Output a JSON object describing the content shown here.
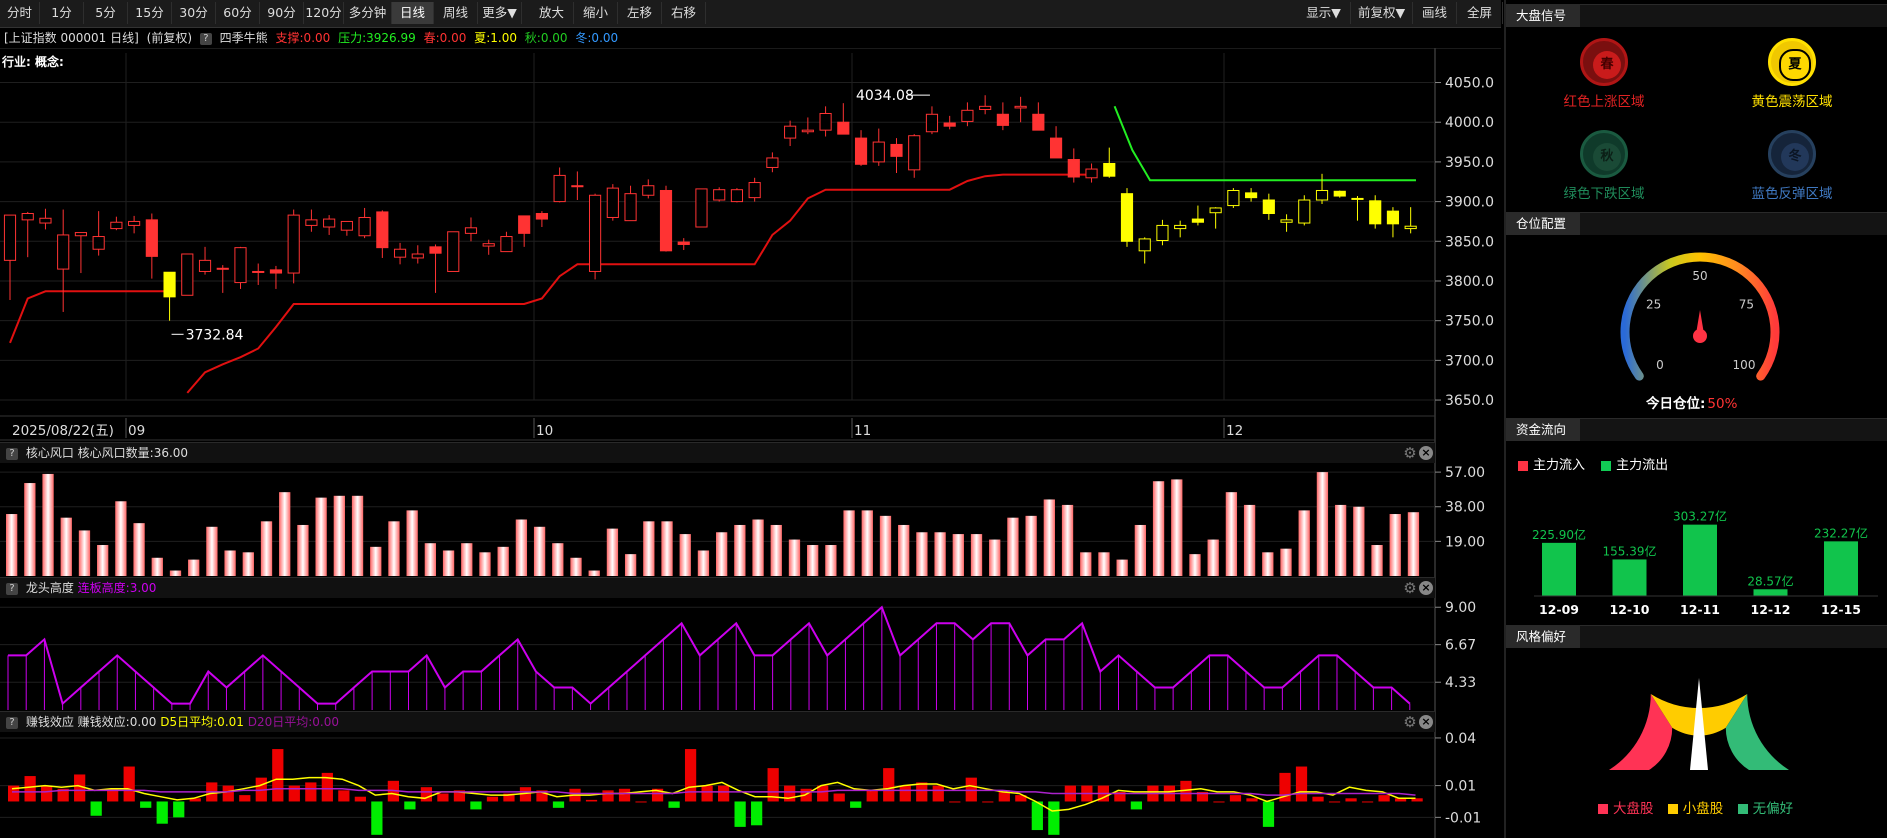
{
  "toolbar": {
    "periods": [
      "分时",
      "1分",
      "5分",
      "15分",
      "30分",
      "60分",
      "90分",
      "120分",
      "多分钟",
      "日线",
      "周线",
      "更多▼",
      "放大",
      "缩小",
      "左移",
      "右移"
    ],
    "active": "日线",
    "right": [
      "显示▼",
      "前复权▼",
      "画线",
      "全屏"
    ]
  },
  "info": {
    "index": "[上证指数 000001 日线]",
    "adjust": "(前复权)",
    "q": "?",
    "indicator": "四季牛熊",
    "support": "支撑:0.00",
    "pressure": "压力:3926.99",
    "spring": "春:0.00",
    "summer": "夏:1.00",
    "autumn": "秋:0.00",
    "winter": "冬:0.00",
    "industry": "行业: 概念:"
  },
  "colors": {
    "up": "#ff3333",
    "down": "#00e5e5",
    "yellow": "#ffff00",
    "support_line": "#e01010",
    "green_line": "#22ee22",
    "magenta": "#cc00ee",
    "bar_green": "#00ee00",
    "bar_red": "#ee0000"
  },
  "chart_data": [
    {
      "type": "candlestick",
      "title": "",
      "date_label": "2025/08/22(五)",
      "month_labels": [
        "09",
        "10",
        "11",
        "12"
      ],
      "y_ticks": [
        "4050.0",
        "4000.0",
        "3950.0",
        "3900.0",
        "3850.0",
        "3800.0",
        "3750.0",
        "3700.0",
        "3650.0"
      ],
      "ylim": [
        3640,
        4062
      ],
      "annotations": [
        {
          "text": "3732.84",
          "value": 3732.84,
          "index": 9
        },
        {
          "text": "4034.08",
          "value": 4034.08,
          "index": 52
        }
      ],
      "candles": [
        [
          3826,
          3883,
          3776,
          3883
        ],
        [
          3877,
          3887,
          3830,
          3885
        ],
        [
          3873,
          3891,
          3865,
          3879
        ],
        [
          3815,
          3890,
          3761,
          3858
        ],
        [
          3857,
          3860,
          3810,
          3861
        ],
        [
          3840,
          3888,
          3832,
          3856
        ],
        [
          3866,
          3881,
          3864,
          3874
        ],
        [
          3870,
          3882,
          3860,
          3875
        ],
        [
          3877,
          3885,
          3803,
          3831
        ],
        [
          3811,
          3811,
          3750,
          3780
        ],
        [
          3782,
          3834,
          3782,
          3834
        ],
        [
          3812,
          3843,
          3808,
          3826
        ],
        [
          3815,
          3820,
          3785,
          3816
        ],
        [
          3798,
          3843,
          3790,
          3842
        ],
        [
          3812,
          3822,
          3795,
          3812
        ],
        [
          3814,
          3819,
          3790,
          3810
        ],
        [
          3810,
          3890,
          3797,
          3883
        ],
        [
          3870,
          3890,
          3862,
          3877
        ],
        [
          3868,
          3883,
          3858,
          3878
        ],
        [
          3864,
          3870,
          3857,
          3875
        ],
        [
          3857,
          3892,
          3854,
          3880
        ],
        [
          3887,
          3889,
          3829,
          3842
        ],
        [
          3830,
          3848,
          3821,
          3840
        ],
        [
          3829,
          3845,
          3822,
          3834
        ],
        [
          3843,
          3846,
          3785,
          3835
        ],
        [
          3812,
          3862,
          3812,
          3862
        ],
        [
          3860,
          3880,
          3850,
          3867
        ],
        [
          3844,
          3852,
          3833,
          3847
        ],
        [
          3837,
          3862,
          3837,
          3856
        ],
        [
          3882,
          3882,
          3843,
          3860
        ],
        [
          3885,
          3888,
          3868,
          3878
        ],
        [
          3900,
          3943,
          3899,
          3933
        ],
        [
          3920,
          3938,
          3902,
          3919
        ],
        [
          3812,
          3910,
          3802,
          3908
        ],
        [
          3880,
          3922,
          3876,
          3917
        ],
        [
          3876,
          3920,
          3876,
          3910
        ],
        [
          3908,
          3928,
          3904,
          3920
        ],
        [
          3914,
          3920,
          3837,
          3838
        ],
        [
          3849,
          3854,
          3839,
          3846
        ],
        [
          3868,
          3912,
          3868,
          3916
        ],
        [
          3902,
          3918,
          3900,
          3915
        ],
        [
          3900,
          3917,
          3899,
          3915
        ],
        [
          3905,
          3930,
          3900,
          3924
        ],
        [
          3943,
          3962,
          3937,
          3955
        ],
        [
          3980,
          4002,
          3970,
          3995
        ],
        [
          3988,
          4006,
          3985,
          3990
        ],
        [
          3990,
          4020,
          3982,
          4011
        ],
        [
          4000,
          4024,
          3990,
          3985
        ],
        [
          3980,
          3990,
          3945,
          3947
        ],
        [
          3950,
          3992,
          3945,
          3975
        ],
        [
          3972,
          3980,
          3936,
          3957
        ],
        [
          3940,
          3985,
          3930,
          3983
        ],
        [
          3988,
          4020,
          3985,
          4010
        ],
        [
          3999,
          4008,
          3991,
          3995
        ],
        [
          4001,
          4025,
          3995,
          4015
        ],
        [
          4016,
          4034,
          4010,
          4020
        ],
        [
          4010,
          4025,
          3990,
          3996
        ],
        [
          4018,
          4032,
          4000,
          4020
        ],
        [
          4010,
          4025,
          3994,
          3990
        ],
        [
          3980,
          3995,
          3960,
          3955
        ],
        [
          3953,
          3967,
          3924,
          3931
        ],
        [
          3930,
          3948,
          3924,
          3941
        ],
        [
          3948,
          3968,
          3930,
          3932
        ],
        [
          3910,
          3917,
          3843,
          3850
        ],
        [
          3838,
          3855,
          3822,
          3853
        ],
        [
          3851,
          3877,
          3845,
          3870
        ],
        [
          3866,
          3876,
          3855,
          3870
        ],
        [
          3878,
          3895,
          3870,
          3874
        ],
        [
          3886,
          3893,
          3866,
          3892
        ],
        [
          3895,
          3917,
          3892,
          3914
        ],
        [
          3911,
          3917,
          3900,
          3905
        ],
        [
          3902,
          3910,
          3877,
          3885
        ],
        [
          3874,
          3884,
          3862,
          3877
        ],
        [
          3873,
          3908,
          3870,
          3902
        ],
        [
          3902,
          3935,
          3897,
          3914
        ],
        [
          3913,
          3914,
          3905,
          3907
        ],
        [
          3903,
          3907,
          3876,
          3904
        ],
        [
          3901,
          3908,
          3866,
          3872
        ],
        [
          3888,
          3893,
          3855,
          3872
        ],
        [
          3866,
          3893,
          3860,
          3869
        ]
      ],
      "candle_colors": [
        "up",
        "down",
        "up",
        "up",
        "down",
        "up",
        "up",
        "up",
        "up",
        "yellow",
        "up",
        "up",
        "up",
        "up",
        "up",
        "up",
        "up",
        "up",
        "up",
        "up",
        "up",
        "up",
        "up",
        "up",
        "up",
        "up",
        "up",
        "up",
        "up",
        "up",
        "up",
        "up",
        "up",
        "up",
        "up",
        "up",
        "up",
        "up",
        "up",
        "up",
        "up",
        "up",
        "up",
        "up",
        "up",
        "up",
        "up",
        "up",
        "up",
        "up",
        "up",
        "up",
        "up",
        "up",
        "up",
        "up",
        "up",
        "up",
        "up",
        "up",
        "up",
        "up",
        "yellow",
        "yellow",
        "yellow",
        "yellow",
        "yellow",
        "yellow",
        "yellow",
        "yellow",
        "yellow",
        "yellow",
        "yellow",
        "yellow",
        "yellow",
        "yellow",
        "yellow",
        "yellow",
        "yellow",
        "yellow"
      ],
      "support_line": [
        3722,
        3778,
        3787,
        3787,
        3787,
        3787,
        3787,
        3787,
        3787,
        3787,
        3659,
        3685,
        3695,
        3704,
        3715,
        3742,
        3771,
        3771,
        3771,
        3771,
        3771,
        3771,
        3771,
        3771,
        3771,
        3771,
        3771,
        3771,
        3771,
        3771,
        3778,
        3806,
        3821,
        3821,
        3821,
        3821,
        3821,
        3821,
        3821,
        3821,
        3821,
        3821,
        3821,
        3858,
        3876,
        3904,
        3915,
        3915,
        3915,
        3915,
        3915,
        3915,
        3915,
        3915,
        3926,
        3932,
        3934,
        3934,
        3934,
        3934,
        3934,
        3934
      ],
      "support_start_index": 0,
      "resistance_line": [
        4020,
        3965,
        3927,
        3927,
        3927,
        3927,
        3927,
        3927,
        3927,
        3927,
        3927,
        3927,
        3927,
        3927,
        3927,
        3927,
        3927,
        3927
      ],
      "resistance_start_index": 62
    },
    {
      "type": "bar",
      "title": "核心风口",
      "label": "核心风口数量:36.00",
      "y_ticks": [
        "57.00",
        "38.00",
        "19.00"
      ],
      "ylim": [
        0,
        62
      ],
      "values": [
        34,
        51,
        56,
        32,
        25,
        17,
        41,
        29,
        10,
        3,
        9,
        27,
        14,
        13,
        30,
        46,
        28,
        43,
        44,
        44,
        16,
        30,
        36,
        18,
        14,
        18,
        13,
        16,
        31,
        27,
        18,
        10,
        3,
        26,
        12,
        30,
        30,
        23,
        14,
        24,
        28,
        31,
        28,
        20,
        17,
        17,
        36,
        36,
        33,
        28,
        24,
        24,
        23,
        23,
        20,
        32,
        33,
        42,
        39,
        13,
        13,
        9,
        28,
        52,
        53,
        12,
        20,
        46,
        39,
        13,
        15,
        36,
        57,
        39,
        38,
        17,
        34,
        35
      ]
    },
    {
      "type": "line",
      "title": "龙头高度",
      "label": "连板高度:3.00",
      "y_ticks": [
        "9.00",
        "6.67",
        "4.33"
      ],
      "ylim": [
        2.6,
        9.7
      ],
      "values": [
        6,
        6,
        7,
        3,
        4,
        5,
        6,
        5,
        4,
        3,
        3,
        5,
        4,
        5,
        6,
        5,
        4,
        3,
        3,
        4,
        5,
        5,
        5,
        6,
        4,
        5,
        5,
        6,
        7,
        5,
        4,
        4,
        3,
        4,
        5,
        6,
        7,
        8,
        6,
        7,
        8,
        6,
        6,
        7,
        8,
        6,
        7,
        8,
        9,
        6,
        7,
        8,
        8,
        7,
        8,
        8,
        6,
        7,
        7,
        8,
        5,
        6,
        5,
        4,
        4,
        5,
        6,
        6,
        5,
        4,
        4,
        5,
        6,
        6,
        5,
        4,
        4,
        3
      ]
    },
    {
      "type": "bar",
      "title": "赚钱效应",
      "label": "赚钱效应:0.00",
      "series_labels": [
        "D5日平均:0.01",
        "D20日平均:0.00"
      ],
      "y_ticks": [
        "0.04",
        "0.01",
        "-0.01"
      ],
      "ylim": [
        -0.023,
        0.045
      ],
      "values": [
        0.01,
        0.016,
        0.01,
        0.008,
        0.017,
        -0.009,
        0.008,
        0.022,
        -0.004,
        -0.014,
        -0.01,
        0.002,
        0.012,
        0.01,
        0.004,
        0.015,
        0.033,
        0.01,
        0.012,
        0.018,
        0.007,
        0.003,
        -0.021,
        0.013,
        -0.005,
        0.009,
        0.005,
        0.007,
        -0.005,
        0.003,
        0.005,
        0.009,
        0.007,
        -0.004,
        0.008,
        0.001,
        0.007,
        0.008,
        0.0,
        0.008,
        -0.004,
        0.033,
        0.01,
        0.01,
        -0.016,
        -0.015,
        0.021,
        0.01,
        0.008,
        0.01,
        0.005,
        -0.004,
        0.007,
        0.021,
        0.01,
        0.012,
        0.01,
        0.0,
        0.015,
        0.0,
        0.007,
        0.004,
        -0.018,
        -0.021,
        0.01,
        0.01,
        0.01,
        0.006,
        -0.005,
        0.01,
        0.01,
        0.013,
        0.006,
        0.0,
        0.004,
        0.002,
        -0.016,
        0.018,
        0.022,
        0.003,
        0.0,
        0.002,
        0.0,
        0.004,
        0.002,
        0.002
      ],
      "d5": [
        0.008,
        0.009,
        0.01,
        0.009,
        0.01,
        0.007,
        0.008,
        0.008,
        0.005,
        0.003,
        0.001,
        0.002,
        0.005,
        0.006,
        0.008,
        0.01,
        0.014,
        0.014,
        0.015,
        0.015,
        0.014,
        0.01,
        0.004,
        0.005,
        0.003,
        0.002,
        0.006,
        0.006,
        0.005,
        0.004,
        0.004,
        0.005,
        0.006,
        0.003,
        0.004,
        0.004,
        0.005,
        0.005,
        0.006,
        0.007,
        0.005,
        0.009,
        0.01,
        0.012,
        0.007,
        0.003,
        0.003,
        0.002,
        0.004,
        0.01,
        0.012,
        0.008,
        0.007,
        0.008,
        0.01,
        0.011,
        0.011,
        0.008,
        0.01,
        0.008,
        0.006,
        0.005,
        0.0,
        -0.006,
        -0.005,
        -0.002,
        0.002,
        0.007,
        0.006,
        0.006,
        0.006,
        0.007,
        0.008,
        0.006,
        0.006,
        0.004,
        0.0,
        0.003,
        0.006,
        0.006,
        0.004,
        0.009,
        0.007,
        0.006,
        0.002,
        0.002
      ],
      "d20": [
        0.006,
        0.006,
        0.006,
        0.007,
        0.007,
        0.007,
        0.007,
        0.007,
        0.007,
        0.006,
        0.006,
        0.006,
        0.006,
        0.006,
        0.007,
        0.007,
        0.008,
        0.008,
        0.008,
        0.008,
        0.008,
        0.007,
        0.007,
        0.007,
        0.006,
        0.006,
        0.006,
        0.006,
        0.006,
        0.006,
        0.006,
        0.006,
        0.006,
        0.006,
        0.005,
        0.005,
        0.005,
        0.005,
        0.005,
        0.005,
        0.005,
        0.006,
        0.006,
        0.006,
        0.006,
        0.006,
        0.006,
        0.006,
        0.006,
        0.006,
        0.007,
        0.007,
        0.007,
        0.007,
        0.007,
        0.007,
        0.007,
        0.007,
        0.007,
        0.007,
        0.007,
        0.006,
        0.006,
        0.005,
        0.005,
        0.005,
        0.005,
        0.005,
        0.005,
        0.005,
        0.005,
        0.005,
        0.005,
        0.005,
        0.005,
        0.005,
        0.004,
        0.004,
        0.005,
        0.005,
        0.005,
        0.005,
        0.005,
        0.005,
        0.005,
        0.004
      ]
    },
    {
      "type": "bar",
      "title": "资金流向",
      "legend": [
        "主力流入",
        "主力流出"
      ],
      "categories": [
        "12-09",
        "12-10",
        "12-11",
        "12-12",
        "12-15"
      ],
      "values": [
        225.9,
        155.39,
        303.27,
        28.57,
        232.27
      ],
      "labels": [
        "225.90亿",
        "155.39亿",
        "303.27亿",
        "28.57亿",
        "232.27亿"
      ],
      "ylim": [
        0,
        340
      ]
    }
  ],
  "panels": {
    "p1": {
      "q": "?",
      "title": "核心风口",
      "label": "核心风口数量:36.00"
    },
    "p2": {
      "q": "?",
      "title": "龙头高度",
      "label": "连板高度:3.00"
    },
    "p3": {
      "q": "?",
      "title": "赚钱效应",
      "label": "赚钱效应:0.00",
      "d5": "D5日平均:0.01",
      "d20": "D20日平均:0.00"
    }
  },
  "side": {
    "signal_title": "大盘信号",
    "seasons": [
      {
        "char": "春",
        "label": "红色上涨区域"
      },
      {
        "char": "夏",
        "label": "黄色震荡区域"
      },
      {
        "char": "秋",
        "label": "绿色下跌区域"
      },
      {
        "char": "冬",
        "label": "蓝色反弹区域"
      }
    ],
    "position_title": "仓位配置",
    "gauge": {
      "ticks": [
        "0",
        "25",
        "50",
        "75",
        "100"
      ],
      "value": 50,
      "label": "今日仓位:",
      "value_text": "50%"
    },
    "fund_title": "资金流向",
    "style_title": "风格偏好",
    "style_legend": [
      "大盘股",
      "小盘股",
      "无偏好"
    ]
  }
}
